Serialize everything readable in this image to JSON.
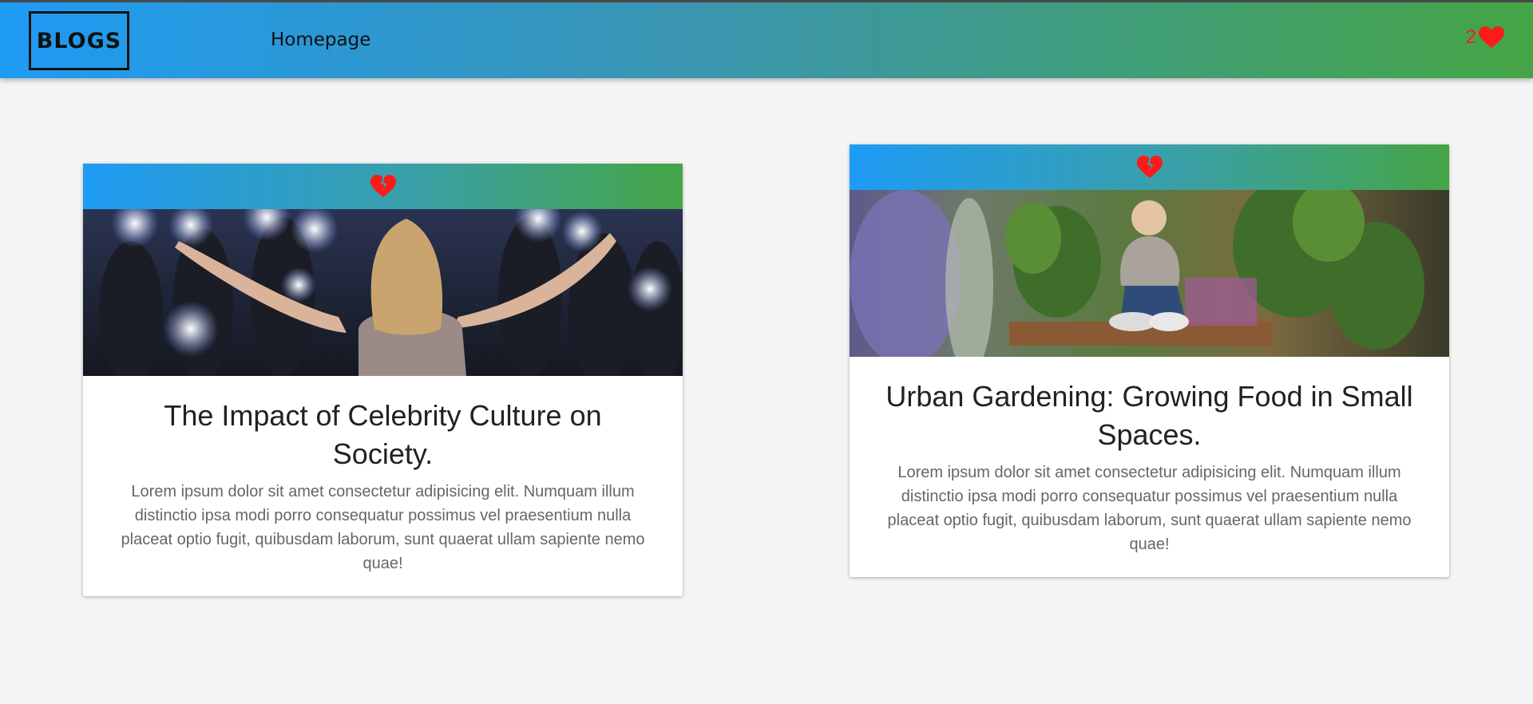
{
  "navbar": {
    "logo": "BLOGS",
    "links": [
      "Homepage"
    ],
    "likes_count": "2"
  },
  "posts": [
    {
      "title": "The Impact of Celebrity Culture on Society.",
      "text": "Lorem ipsum dolor sit amet consectetur adipisicing elit. Numquam illum distinctio ipsa modi porro consequatur possimus vel praesentium nulla placeat optio fugit, quibusdam laborum, sunt quaerat ullam sapiente nemo quae!",
      "like_icon": "broken-heart-icon"
    },
    {
      "title": "Urban Gardening: Growing Food in Small Spaces.",
      "text": "Lorem ipsum dolor sit amet consectetur adipisicing elit. Numquam illum distinctio ipsa modi porro consequatur possimus vel praesentium nulla placeat optio fugit, quibusdam laborum, sunt quaerat ullam sapiente nemo quae!",
      "like_icon": "broken-heart-icon"
    }
  ],
  "colors": {
    "gradient_start": "#1e9bf5",
    "gradient_end": "#45a545",
    "heart": "#ff1a1a"
  }
}
